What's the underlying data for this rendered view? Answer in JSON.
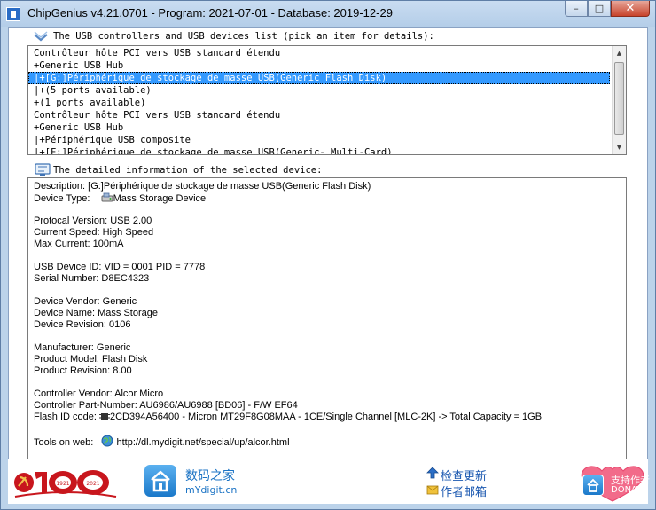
{
  "window": {
    "title": "ChipGenius v4.21.0701 - Program: 2021-07-01 - Database: 2019-12-29",
    "controls": {
      "minimize": "–",
      "maximize": "□",
      "close": "✕"
    }
  },
  "device_list": {
    "header": "The USB controllers and USB devices list (pick an item for details):",
    "items": [
      {
        "label": "Contrôleur hôte PCI vers USB standard étendu"
      },
      {
        "label": "+Generic USB Hub"
      },
      {
        "label": "|+[G:]Périphérique de stockage de masse USB(Generic Flash Disk)"
      },
      {
        "label": "|+(5 ports available)"
      },
      {
        "label": "+(1 ports available)"
      },
      {
        "label": "Contrôleur hôte PCI vers USB standard étendu"
      },
      {
        "label": "+Generic USB Hub"
      },
      {
        "label": "|+Périphérique USB composite"
      },
      {
        "label": "|+[F:]Périphérique de stockage de masse USB(Generic- Multi-Card)"
      }
    ],
    "selected_index": 2
  },
  "details": {
    "header": "The detailed information of the selected device:",
    "description": "Description: [G:]Périphérique de stockage de masse USB(Generic Flash Disk)",
    "device_type_label": "Device Type:",
    "device_type_value": "Mass Storage Device",
    "protocol_version": "Protocal Version: USB 2.00",
    "current_speed": "Current Speed: High Speed",
    "max_current": "Max Current: 100mA",
    "usb_device_id": "USB Device ID: VID = 0001 PID = 7778",
    "serial_number": "Serial Number: D8EC4323",
    "device_vendor": "Device Vendor: Generic",
    "device_name": "Device Name: Mass Storage",
    "device_revision": "Device Revision: 0106",
    "manufacturer": "Manufacturer: Generic",
    "product_model": "Product Model: Flash Disk",
    "product_revision": "Product Revision: 8.00",
    "controller_vendor": "Controller Vendor: Alcor Micro",
    "controller_part": "Controller Part-Number: AU6986/AU6988 [BD06] - F/W EF64",
    "flash_id_label": "Flash ID code:",
    "flash_id_value": "2CD394A56400 - Micron MT29F8G08MAA - 1CE/Single Channel [MLC-2K] -> Total Capacity = 1GB",
    "tools_label": "Tools on web:",
    "tools_url": "http://dl.mydigit.net/special/up/alcor.html"
  },
  "footer": {
    "logo_year_left": "1921",
    "logo_year_right": "2021",
    "site_name_cn": "数码之家",
    "site_name_en": "mYdigit.cn",
    "check_update": "检查更新",
    "author_email": "作者邮箱",
    "donate_cn": "支持作者",
    "donate_en": "DONATE"
  },
  "colors": {
    "selection": "#3399ff",
    "frame": "#bcd3ea",
    "link_blue": "#1b58b0",
    "logo_red": "#c8161d",
    "logo_gold": "#f2c14e"
  }
}
